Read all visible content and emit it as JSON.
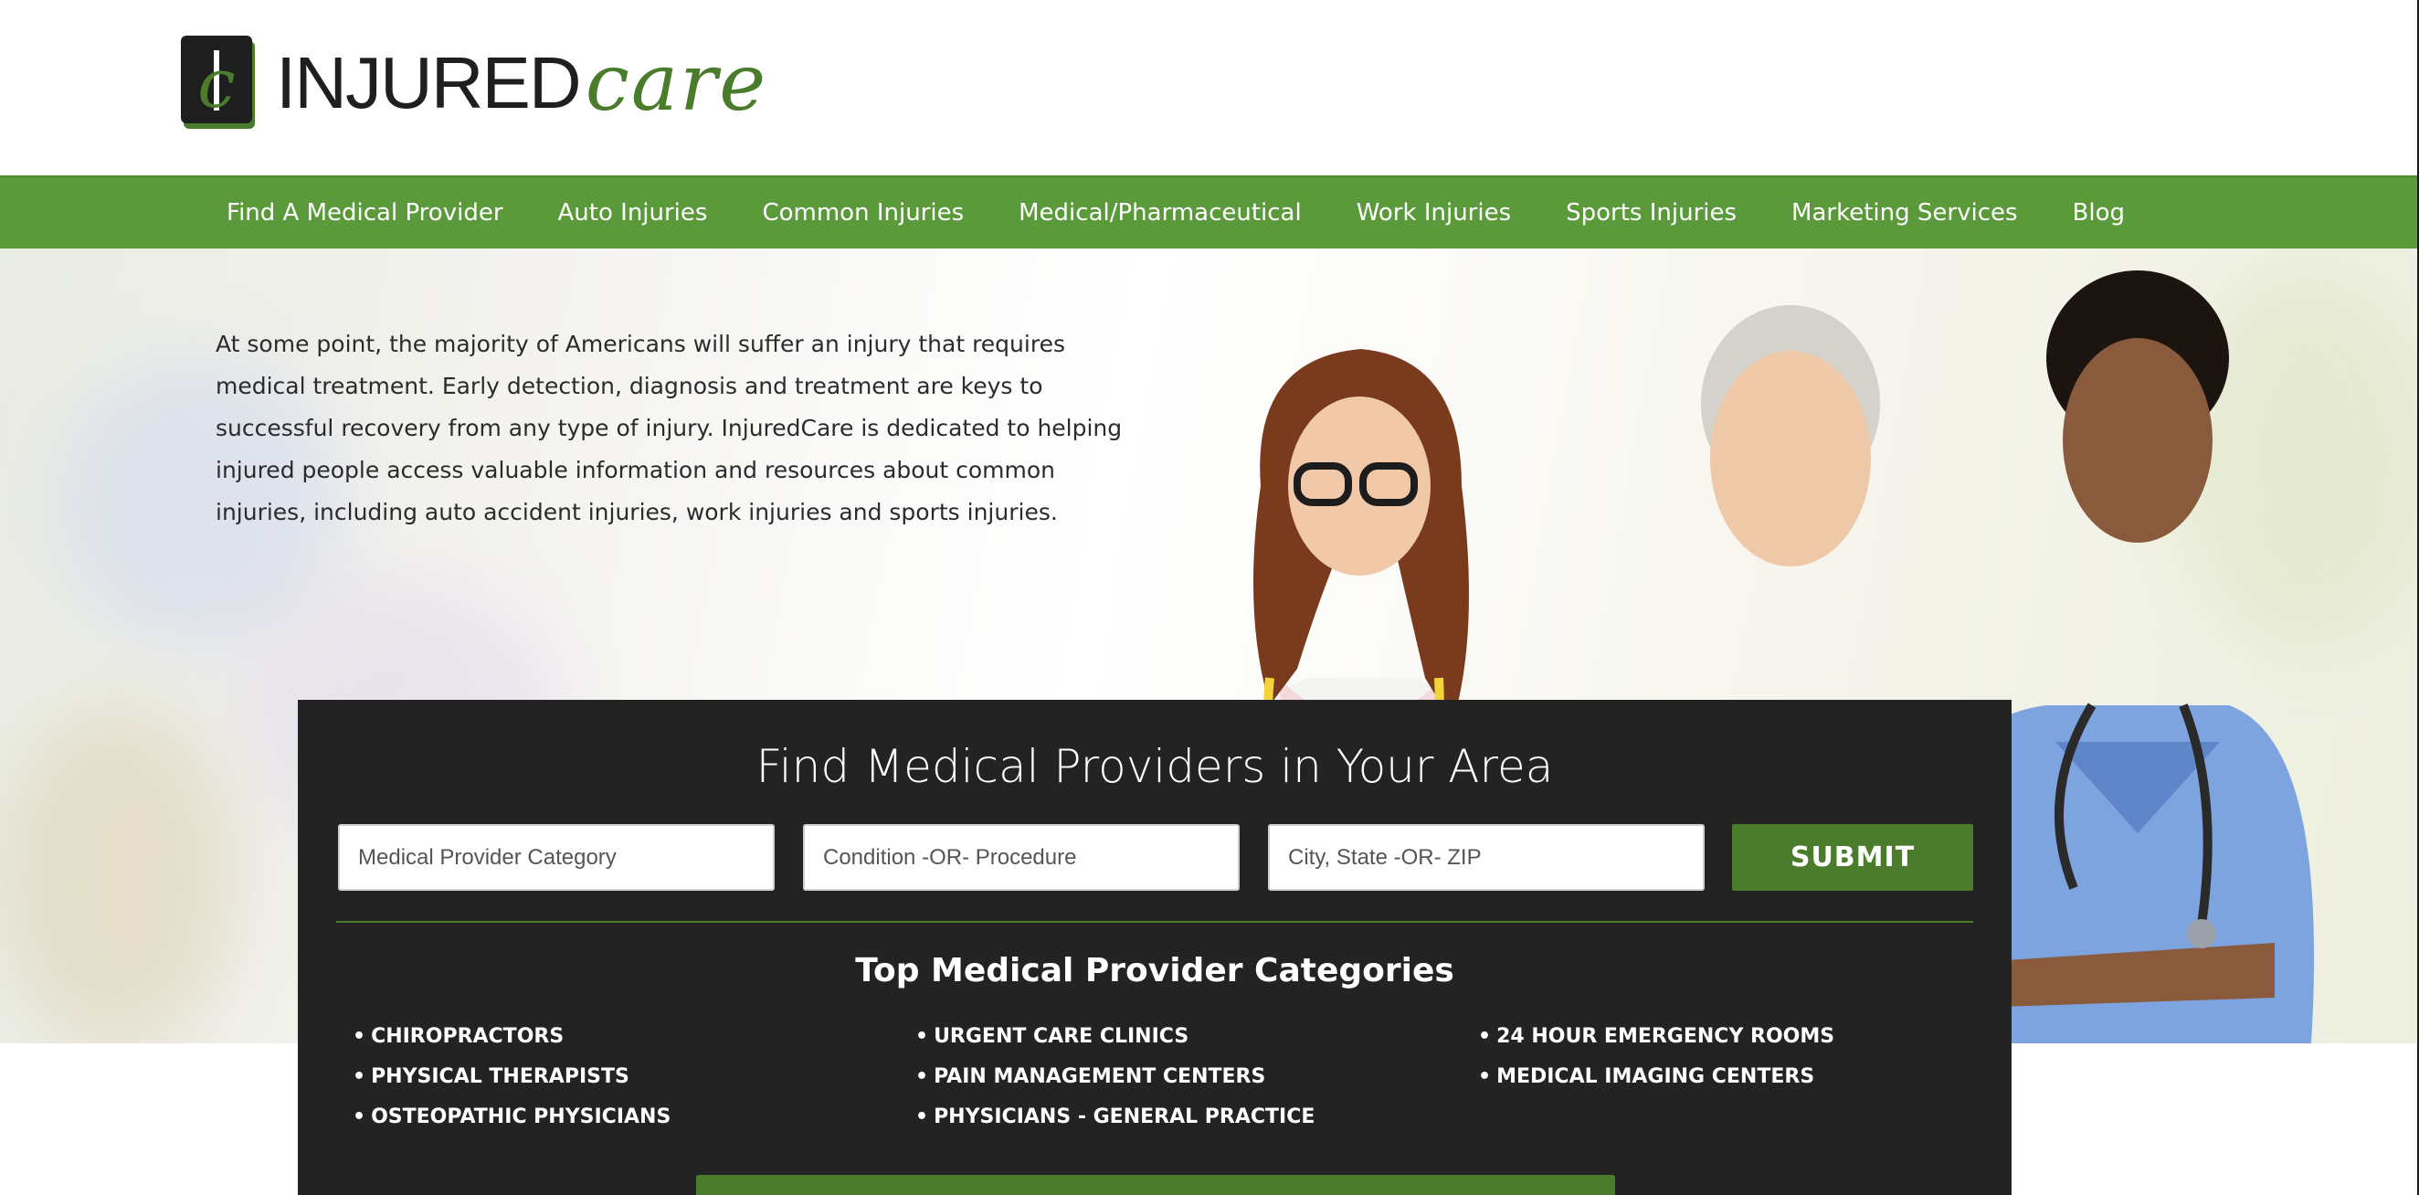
{
  "header": {
    "logo_mark_letter": "c",
    "logo_text_injured": "INJURED",
    "logo_text_care": "care",
    "brand_green": "#4a7c2c",
    "nav_green": "#5b9a3b"
  },
  "nav": {
    "items": [
      "Find A Medical Provider",
      "Auto Injuries",
      "Common Injuries",
      "Medical/Pharmaceutical",
      "Work Injuries",
      "Sports Injuries",
      "Marketing Services",
      "Blog"
    ]
  },
  "hero": {
    "text": "At some point, the majority of Americans will suffer an injury that requires medical treatment. Early detection, diagnosis and treatment are keys to successful recovery from any type of injury. InjuredCare is dedicated to helping injured people access valuable information and resources about common injuries, including auto accident injuries, work injuries and sports injuries."
  },
  "finder": {
    "title": "Find Medical Providers in Your Area",
    "category_placeholder": "Medical Provider Category",
    "condition_placeholder": "Condition -OR- Procedure",
    "location_placeholder": "City, State -OR- ZIP",
    "submit_label": "SUBMIT",
    "categories_title": "Top Medical Provider Categories",
    "categories": [
      [
        "CHIROPRACTORS",
        "PHYSICAL THERAPISTS",
        "OSTEOPATHIC PHYSICIANS"
      ],
      [
        "URGENT CARE CLINICS",
        "PAIN MANAGEMENT CENTERS",
        "PHYSICIANS - GENERAL PRACTICE"
      ],
      [
        "24 HOUR EMERGENCY ROOMS",
        "MEDICAL IMAGING CENTERS"
      ]
    ]
  }
}
